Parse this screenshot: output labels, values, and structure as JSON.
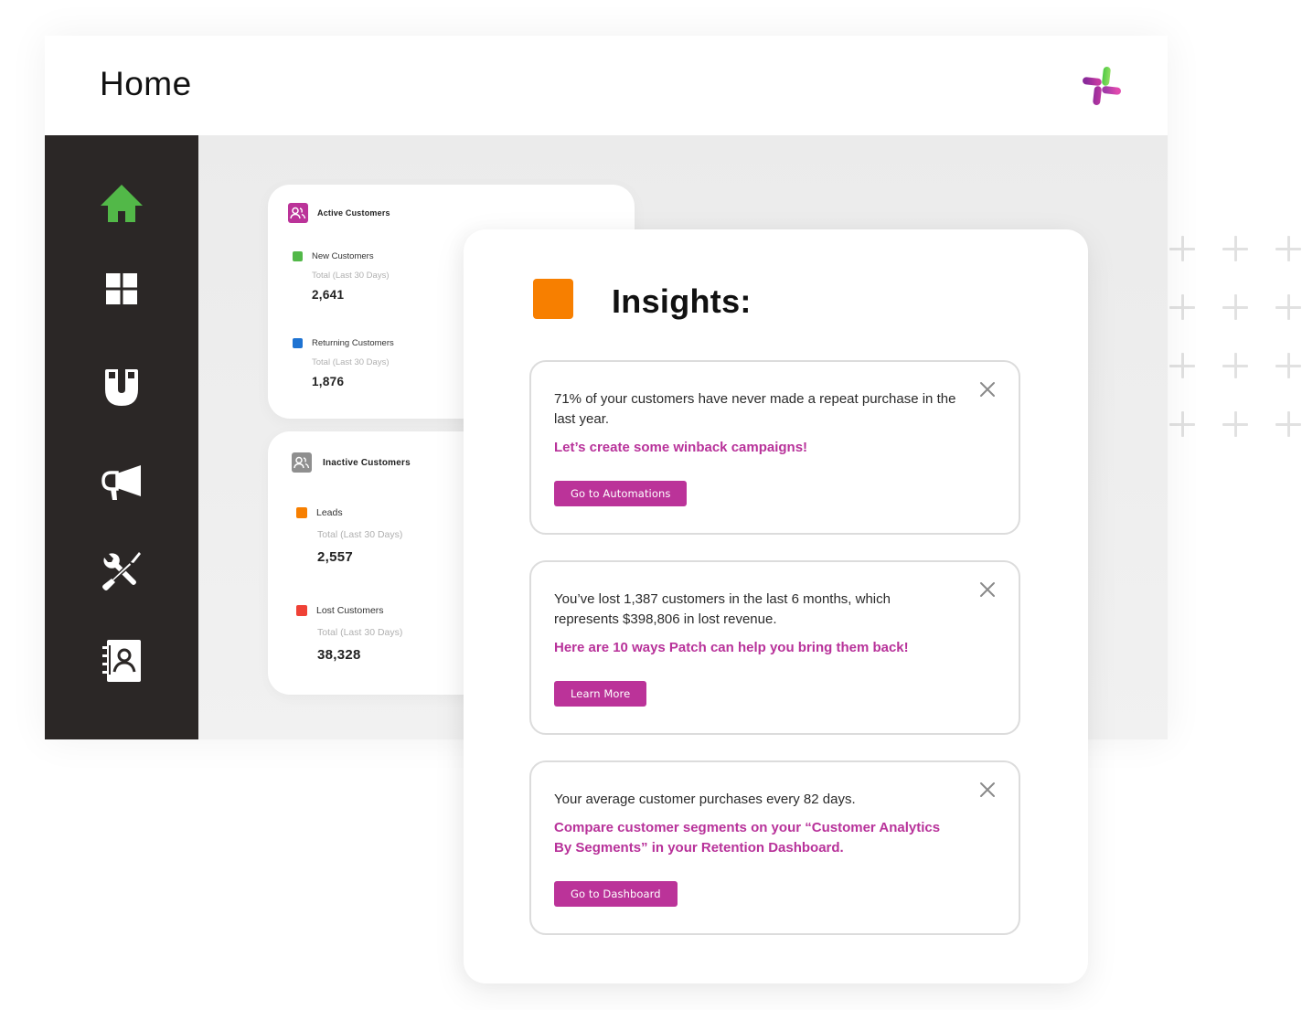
{
  "header": {
    "title": "Home",
    "logo": "patch-logo"
  },
  "sidebar": {
    "items": [
      {
        "id": "home",
        "icon": "home-icon",
        "active": true
      },
      {
        "id": "dashboard",
        "icon": "grid-icon",
        "active": false
      },
      {
        "id": "retention",
        "icon": "magnet-icon",
        "active": false
      },
      {
        "id": "campaigns",
        "icon": "megaphone-icon",
        "active": false
      },
      {
        "id": "tools",
        "icon": "tools-icon",
        "active": false
      },
      {
        "id": "contacts",
        "icon": "contacts-book-icon",
        "active": false
      }
    ]
  },
  "colors": {
    "accent": "#bb3399",
    "sidebar_bg": "#2b2726",
    "home_active": "#52b848",
    "insights_marker": "#f77f00",
    "new_customers": "#52b848",
    "returning_customers": "#1e73d2",
    "leads": "#f77f00",
    "lost_customers": "#ef4136"
  },
  "active_customers": {
    "title": "Active Customers",
    "metrics": [
      {
        "name": "New Customers",
        "sub": "Total (Last 30 Days)",
        "value": "2,641"
      },
      {
        "name": "Returning Customers",
        "sub": "Total (Last 30 Days)",
        "value": "1,876"
      }
    ]
  },
  "inactive_customers": {
    "title": "Inactive Customers",
    "metrics": [
      {
        "name": "Leads",
        "sub": "Total (Last 30 Days)",
        "value": "2,557"
      },
      {
        "name": "Lost Customers",
        "sub": "Total (Last 30 Days)",
        "value": "38,328"
      }
    ]
  },
  "insights": {
    "title": "Insights:",
    "cards": [
      {
        "message": "71% of your customers have never made a repeat purchase in the last year.",
        "cta": "Let’s create some winback campaigns!",
        "button": "Go to Automations"
      },
      {
        "message": "You’ve lost 1,387 customers in the last 6 months, which represents $398,806 in lost revenue.",
        "cta": "Here are 10 ways Patch can help you bring them back!",
        "button": "Learn More"
      },
      {
        "message": "Your average customer purchases every 82 days.",
        "cta": "Compare customer segments on your “Customer Analytics By Segments” in your Retention Dashboard.",
        "button": "Go to Dashboard"
      }
    ]
  }
}
